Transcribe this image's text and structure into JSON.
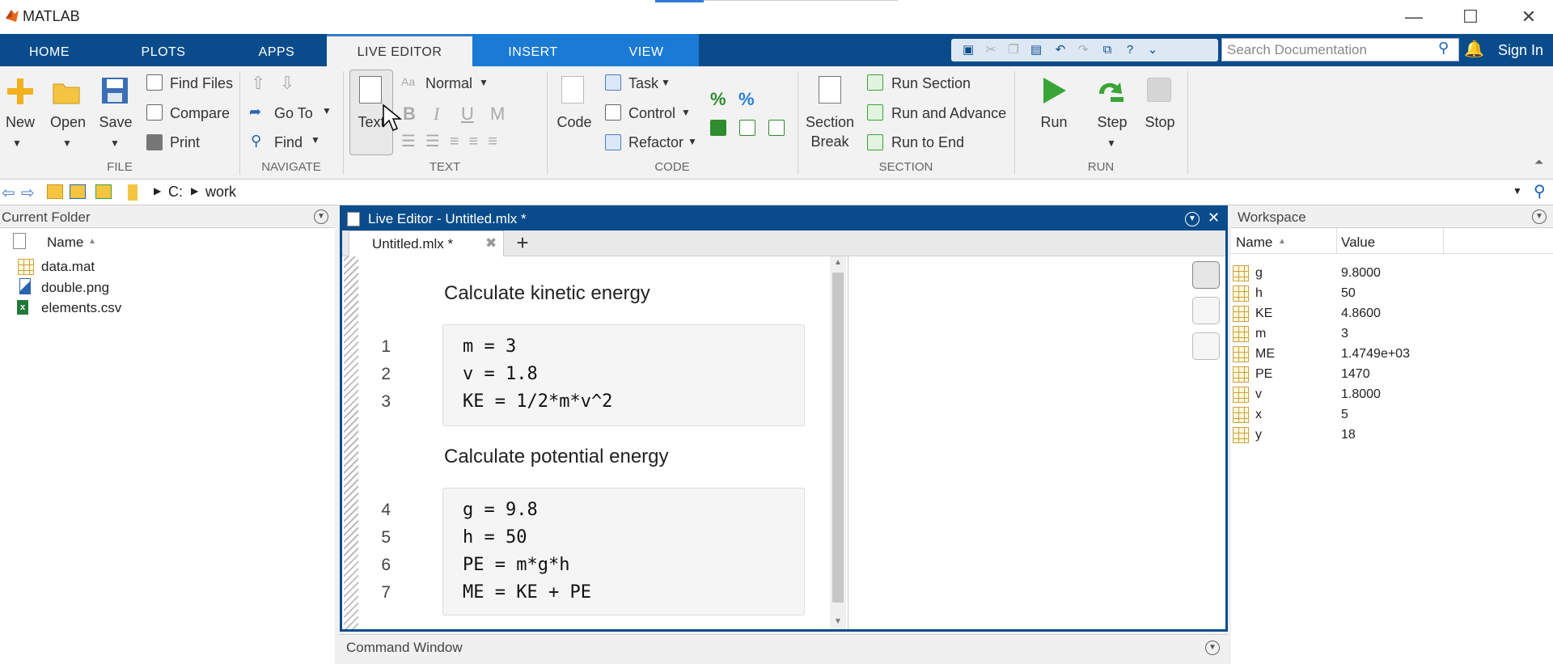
{
  "app": {
    "title": "MATLAB"
  },
  "window_controls": {
    "minimize": "—",
    "maximize": "☐",
    "close": "✕"
  },
  "tabs": [
    "HOME",
    "PLOTS",
    "APPS",
    "LIVE EDITOR",
    "INSERT",
    "VIEW"
  ],
  "search": {
    "placeholder": "Search Documentation"
  },
  "sign_in": "Sign In",
  "ribbon": {
    "file": {
      "section": "FILE",
      "new": "New",
      "open": "Open",
      "save": "Save",
      "find_files": "Find Files",
      "compare": "Compare",
      "print": "Print"
    },
    "navigate": {
      "section": "NAVIGATE",
      "go_to": "Go To",
      "find": "Find"
    },
    "text": {
      "section": "TEXT",
      "text": "Text",
      "style": "Normal",
      "bold": "B",
      "italic": "I",
      "underline": "U",
      "mono": "M"
    },
    "code": {
      "section": "CODE",
      "code": "Code",
      "task": "Task",
      "control": "Control",
      "refactor": "Refactor"
    },
    "section": {
      "section": "SECTION",
      "section_break_1": "Section",
      "section_break_2": "Break",
      "run_section": "Run Section",
      "run_and_advance": "Run and Advance",
      "run_to_end": "Run to End"
    },
    "run": {
      "section": "RUN",
      "run": "Run",
      "step": "Step",
      "stop": "Stop"
    }
  },
  "address": {
    "drive": "C:",
    "folder": "work"
  },
  "current_folder": {
    "title": "Current Folder",
    "column": "Name",
    "files": [
      {
        "name": "data.mat",
        "icon": "mat-file-icon"
      },
      {
        "name": "double.png",
        "icon": "image-file-icon"
      },
      {
        "name": "elements.csv",
        "icon": "csv-file-icon"
      }
    ]
  },
  "editor": {
    "title": "Live Editor - Untitled.mlx *",
    "tab": "Untitled.mlx *",
    "text1": "Calculate kinetic energy",
    "block1": [
      {
        "ln": "1",
        "code": "m = 3"
      },
      {
        "ln": "2",
        "code": "v = 1.8"
      },
      {
        "ln": "3",
        "code": "KE = 1/2*m*v^2"
      }
    ],
    "text2": "Calculate potential energy",
    "block2": [
      {
        "ln": "4",
        "code": "g = 9.8"
      },
      {
        "ln": "5",
        "code": "h = 50"
      },
      {
        "ln": "6",
        "code": "PE = m*g*h"
      },
      {
        "ln": "7",
        "code": "ME = KE + PE"
      }
    ]
  },
  "workspace": {
    "title": "Workspace",
    "col_name": "Name",
    "col_value": "Value",
    "vars": [
      {
        "name": "g",
        "value": "9.8000"
      },
      {
        "name": "h",
        "value": "50"
      },
      {
        "name": "KE",
        "value": "4.8600"
      },
      {
        "name": "m",
        "value": "3"
      },
      {
        "name": "ME",
        "value": "1.4749e+03"
      },
      {
        "name": "PE",
        "value": "1470"
      },
      {
        "name": "v",
        "value": "1.8000"
      },
      {
        "name": "x",
        "value": "5"
      },
      {
        "name": "y",
        "value": "18"
      }
    ]
  },
  "command_window": {
    "title": "Command Window"
  },
  "colors": {
    "tab_bar": "#0a4c8b",
    "tab_active_blue": "#1a7ad4",
    "run_green": "#3aa537"
  }
}
